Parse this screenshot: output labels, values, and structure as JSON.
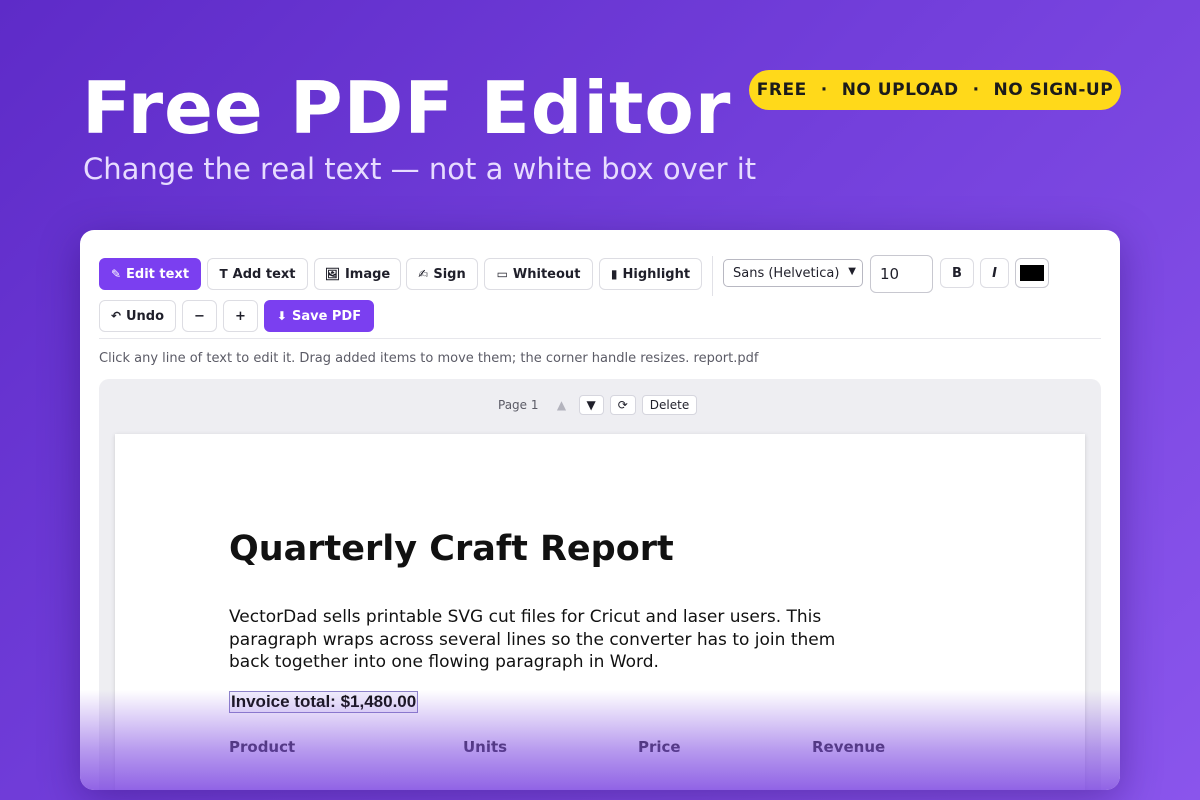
{
  "hero": {
    "title": "Free PDF Editor",
    "subtitle": "Change the real text — not a white box over it",
    "badge": {
      "items": [
        "FREE",
        "NO UPLOAD",
        "NO SIGN-UP"
      ],
      "separator": "·"
    }
  },
  "toolbar": {
    "edit_text": "Edit text",
    "add_text": "Add text",
    "image": "Image",
    "sign": "Sign",
    "whiteout": "Whiteout",
    "highlight": "Highlight",
    "font_select": "Sans (Helvetica)",
    "font_size": "10",
    "bold": "B",
    "italic": "I",
    "undo": "Undo",
    "zoom_out": "−",
    "zoom_in": "+",
    "save": "Save PDF",
    "color": "#000000",
    "icons": {
      "edit_text": "pencil-icon",
      "add_text": "text-icon",
      "image": "image-icon",
      "sign": "signature-icon",
      "whiteout": "rectangle-icon",
      "highlight": "highlighter-icon",
      "undo": "undo-icon",
      "save": "download-icon"
    }
  },
  "hint": "Click any line of text to edit it. Drag added items to move them; the corner handle resizes. report.pdf",
  "pagebar": {
    "label": "Page 1",
    "move_up": "▲",
    "move_down": "▼",
    "rotate": "⟳",
    "delete": "Delete"
  },
  "document": {
    "title": "Quarterly Craft Report",
    "paragraph_lines": [
      "VectorDad sells printable SVG cut files for Cricut and laser users. This",
      "paragraph wraps across several lines so the converter has to join them",
      "back together into one flowing paragraph in Word."
    ],
    "invoice": "Invoice total: $1,480.00",
    "table_headers": [
      "Product",
      "Units",
      "Price",
      "Revenue"
    ]
  },
  "colors": {
    "accent": "#7b3ff0",
    "badge": "#ffd91a",
    "background_start": "#5e2bc8",
    "background_end": "#8a55ec"
  }
}
